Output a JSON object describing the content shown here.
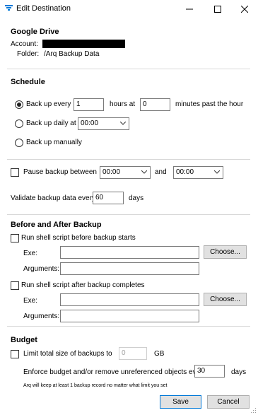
{
  "window": {
    "title": "Edit Destination",
    "accent": "#0078d7"
  },
  "google_drive": {
    "heading": "Google Drive",
    "account_label": "Account:",
    "folder_label": "Folder:",
    "folder_value": "/Arq Backup Data"
  },
  "schedule": {
    "heading": "Schedule",
    "backup_every_label": "Back up every",
    "hours_value": "1",
    "hours_at_label": "hours at",
    "minutes_value": "0",
    "minutes_suffix": "minutes past the hour",
    "daily_label": "Back up daily at",
    "daily_time": "00:00",
    "manual_label": "Back up manually",
    "selected": "every"
  },
  "pause": {
    "label": "Pause backup between",
    "from": "00:00",
    "and_label": "and",
    "to": "00:00",
    "checked": false
  },
  "validate": {
    "label": "Validate backup data every",
    "value": "60",
    "suffix": "days"
  },
  "before_after": {
    "heading": "Before and After Backup",
    "before_label": "Run shell script before backup starts",
    "after_label": "Run shell script after backup completes",
    "exe_label": "Exe:",
    "arguments_label": "Arguments:",
    "choose_label": "Choose...",
    "before_exe": "",
    "before_args": "",
    "after_exe": "",
    "after_args": ""
  },
  "budget": {
    "heading": "Budget",
    "limit_label": "Limit total size of backups to",
    "limit_value": "0",
    "limit_unit": "GB",
    "enforce_label": "Enforce budget and/or remove unreferenced objects every",
    "enforce_value": "30",
    "enforce_unit": "days",
    "note": "Arq will keep at least 1 backup record no matter what limit you set"
  },
  "footer": {
    "save_label": "Save",
    "cancel_label": "Cancel"
  }
}
